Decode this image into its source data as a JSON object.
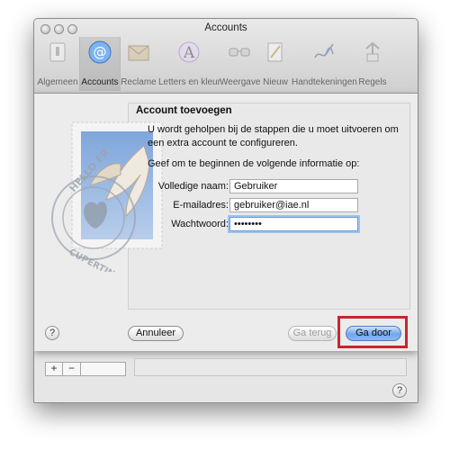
{
  "window": {
    "title": "Accounts"
  },
  "toolbar": {
    "items": [
      {
        "label": "Algemeen",
        "icon": "switch-icon"
      },
      {
        "label": "Accounts",
        "icon": "at-icon"
      },
      {
        "label": "Reclame",
        "icon": "junk-mail-icon"
      },
      {
        "label": "Letters en kleur",
        "icon": "fonts-colors-icon"
      },
      {
        "label": "Weergave",
        "icon": "glasses-icon"
      },
      {
        "label": "Nieuw",
        "icon": "compose-icon"
      },
      {
        "label": "Handtekeningen",
        "icon": "signature-icon"
      },
      {
        "label": "Regels",
        "icon": "rules-icon"
      }
    ]
  },
  "sheet": {
    "heading": "Account toevoegen",
    "intro": "U wordt geholpen bij de stappen die u moet uitvoeren om een extra account te configureren.",
    "prompt": "Geef om te beginnen de volgende informatie op:",
    "fields": {
      "name": {
        "label": "Volledige naam:",
        "value": "Gebruiker"
      },
      "email": {
        "label": "E-mailadres:",
        "value": "gebruiker@iae.nl"
      },
      "password": {
        "label": "Wachtwoord:",
        "value": "••••••••"
      }
    },
    "stamp_text": "HELLO FROM CUPERTINO",
    "buttons": {
      "help": "?",
      "cancel": "Annuleer",
      "back": "Ga terug",
      "continue": "Ga door"
    }
  },
  "bottom_bar": {
    "add": "+",
    "remove": "−",
    "help": "?"
  },
  "colors": {
    "accent": "#6fa7ea",
    "highlight": "#c8262b"
  }
}
